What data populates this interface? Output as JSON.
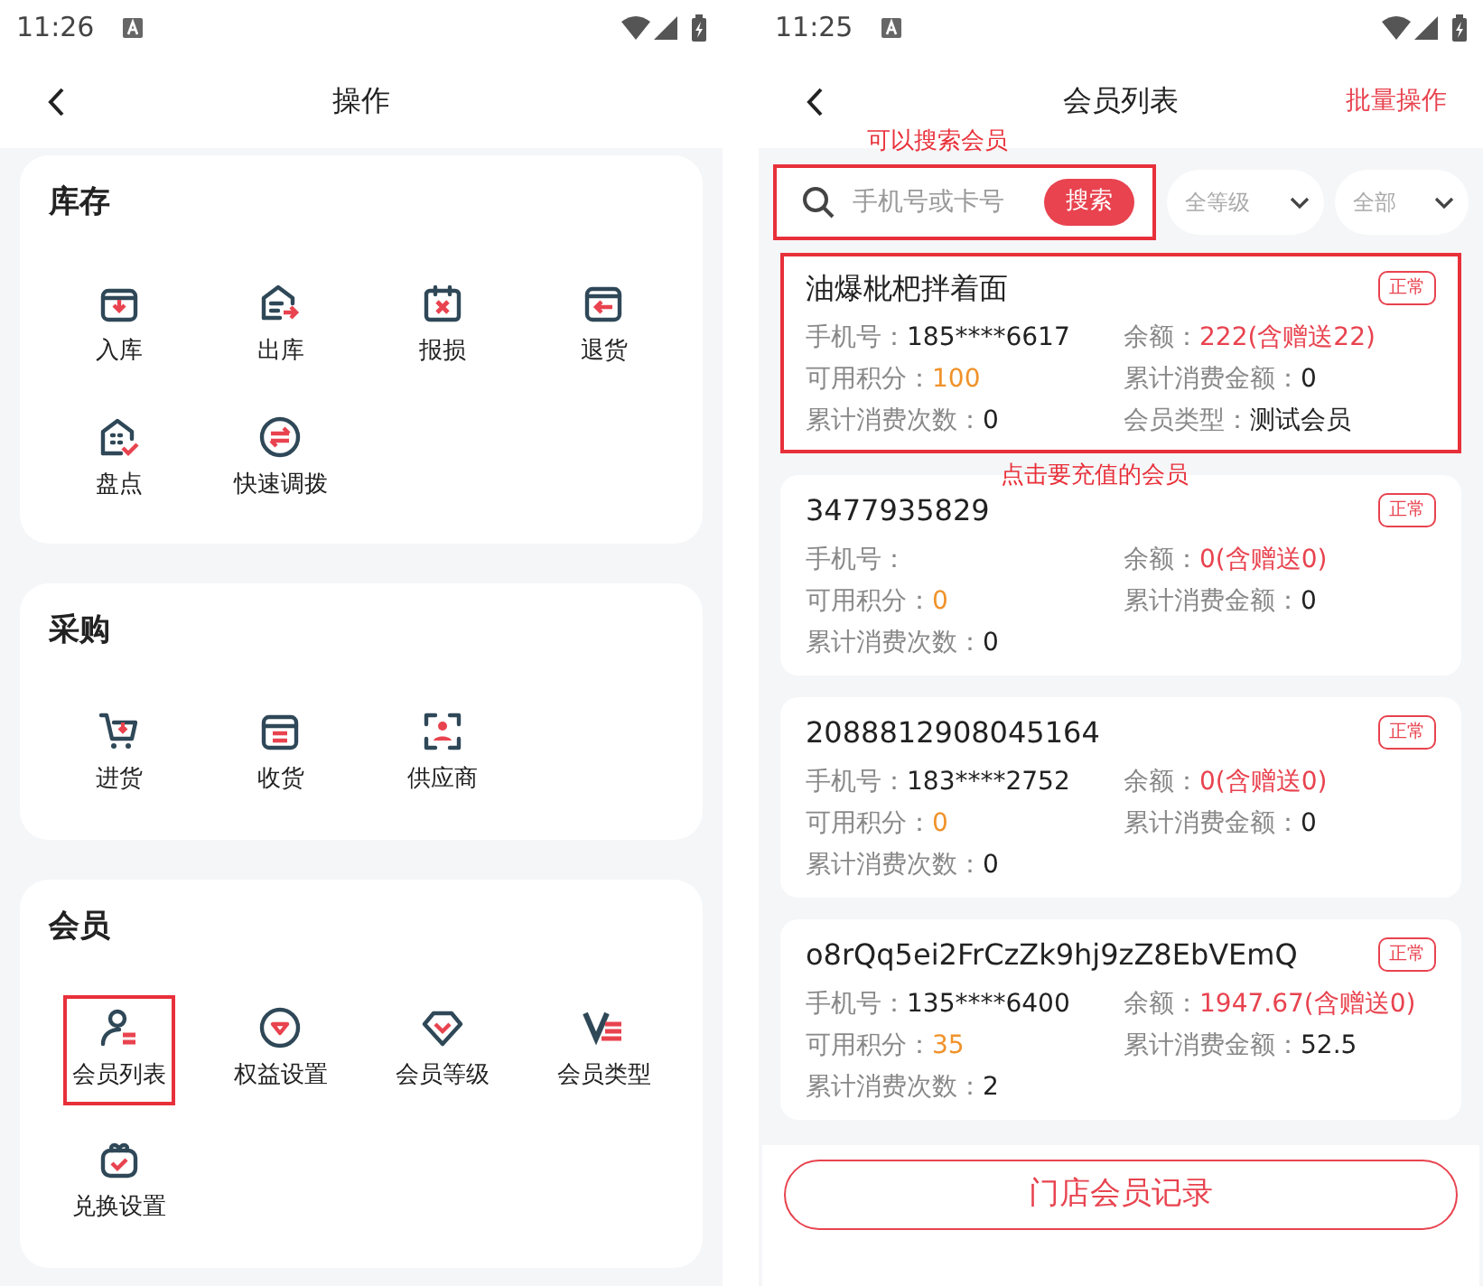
{
  "left_screen": {
    "status_time": "11:26",
    "title": "操作",
    "sections": [
      {
        "title": "库存",
        "items": [
          {
            "label": "入库",
            "highlighted": false
          },
          {
            "label": "出库",
            "highlighted": false
          },
          {
            "label": "报损",
            "highlighted": false
          },
          {
            "label": "退货",
            "highlighted": false
          },
          {
            "label": "盘点",
            "highlighted": false
          },
          {
            "label": "快速调拨",
            "highlighted": false
          }
        ]
      },
      {
        "title": "采购",
        "items": [
          {
            "label": "进货",
            "highlighted": false
          },
          {
            "label": "收货",
            "highlighted": false
          },
          {
            "label": "供应商",
            "highlighted": false
          }
        ]
      },
      {
        "title": "会员",
        "items": [
          {
            "label": "会员列表",
            "highlighted": true
          },
          {
            "label": "权益设置",
            "highlighted": false
          },
          {
            "label": "会员等级",
            "highlighted": false
          },
          {
            "label": "会员类型",
            "highlighted": false
          },
          {
            "label": "兑换设置",
            "highlighted": false
          }
        ]
      }
    ]
  },
  "right_screen": {
    "status_time": "11:25",
    "title": "会员列表",
    "action": "批量操作",
    "search": {
      "placeholder": "手机号或卡号",
      "button": "搜索",
      "highlighted": true,
      "note": "可以搜索会员"
    },
    "filters": [
      {
        "label": "全等级"
      },
      {
        "label": "全部"
      }
    ],
    "members": [
      {
        "name": "油爆枇杷拌着面",
        "status": "正常",
        "highlighted": true,
        "note": "点击要充值的会员",
        "fields": [
          {
            "label": "手机号：",
            "value": "185****6617",
            "kind": "plain"
          },
          {
            "label": "余额：",
            "value": "222(含赠送22)",
            "kind": "balance"
          },
          {
            "label": "可用积分：",
            "value": "100",
            "kind": "points"
          },
          {
            "label": "累计消费金额：",
            "value": "0",
            "kind": "plain"
          },
          {
            "label": "累计消费次数：",
            "value": "0",
            "kind": "plain"
          },
          {
            "label": "会员类型：",
            "value": "测试会员",
            "kind": "plain"
          }
        ]
      },
      {
        "name": "3477935829",
        "status": "正常",
        "highlighted": false,
        "fields": [
          {
            "label": "手机号："
          },
          {
            "label": "余额：",
            "value": "0(含赠送0)",
            "kind": "balance"
          },
          {
            "label": "可用积分：",
            "value": "0",
            "kind": "points"
          },
          {
            "label": "累计消费金额：",
            "value": "0",
            "kind": "plain"
          },
          {
            "label": "累计消费次数：",
            "value": "0",
            "kind": "plain"
          }
        ]
      },
      {
        "name": "2088812908045164",
        "status": "正常",
        "highlighted": false,
        "fields": [
          {
            "label": "手机号：",
            "value": "183****2752",
            "kind": "plain"
          },
          {
            "label": "余额：",
            "value": "0(含赠送0)",
            "kind": "balance"
          },
          {
            "label": "可用积分：",
            "value": "0",
            "kind": "points"
          },
          {
            "label": "累计消费金额：",
            "value": "0",
            "kind": "plain"
          },
          {
            "label": "累计消费次数：",
            "value": "0",
            "kind": "plain"
          }
        ]
      },
      {
        "name": "o8rQq5ei2FrCzZk9hj9zZ8EbVEmQ",
        "status": "正常",
        "highlighted": false,
        "fields": [
          {
            "label": "手机号：",
            "value": "135****6400",
            "kind": "plain"
          },
          {
            "label": "余额：",
            "value": "1947.67(含赠送0)",
            "kind": "balance"
          },
          {
            "label": "可用积分：",
            "value": "35",
            "kind": "points"
          },
          {
            "label": "累计消费金额：",
            "value": "52.5",
            "kind": "plain"
          },
          {
            "label": "累计消费次数：",
            "value": "2",
            "kind": "plain"
          }
        ]
      }
    ],
    "bottom_button": "门店会员记录"
  }
}
